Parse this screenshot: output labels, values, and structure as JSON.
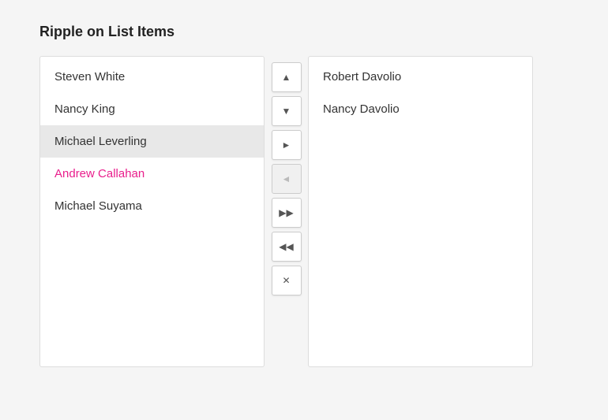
{
  "title": "Ripple on List Items",
  "left_list": {
    "items": [
      {
        "label": "Steven White",
        "state": "normal"
      },
      {
        "label": "Nancy King",
        "state": "normal"
      },
      {
        "label": "Michael Leverling",
        "state": "highlighted"
      },
      {
        "label": "Andrew Callahan",
        "state": "accent"
      },
      {
        "label": "Michael Suyama",
        "state": "normal"
      }
    ]
  },
  "controls": [
    {
      "id": "move-up",
      "symbol": "▲",
      "disabled": false
    },
    {
      "id": "move-down",
      "symbol": "▼",
      "disabled": false
    },
    {
      "id": "move-right",
      "symbol": "►",
      "disabled": false
    },
    {
      "id": "move-left",
      "symbol": "◄",
      "disabled": true
    },
    {
      "id": "move-all-right",
      "symbol": "▶▶",
      "disabled": false
    },
    {
      "id": "move-all-left",
      "symbol": "◀◀",
      "disabled": false
    },
    {
      "id": "remove",
      "symbol": "✕",
      "disabled": false
    }
  ],
  "right_list": {
    "items": [
      {
        "label": "Robert Davolio",
        "state": "normal"
      },
      {
        "label": "Nancy Davolio",
        "state": "normal"
      }
    ]
  }
}
